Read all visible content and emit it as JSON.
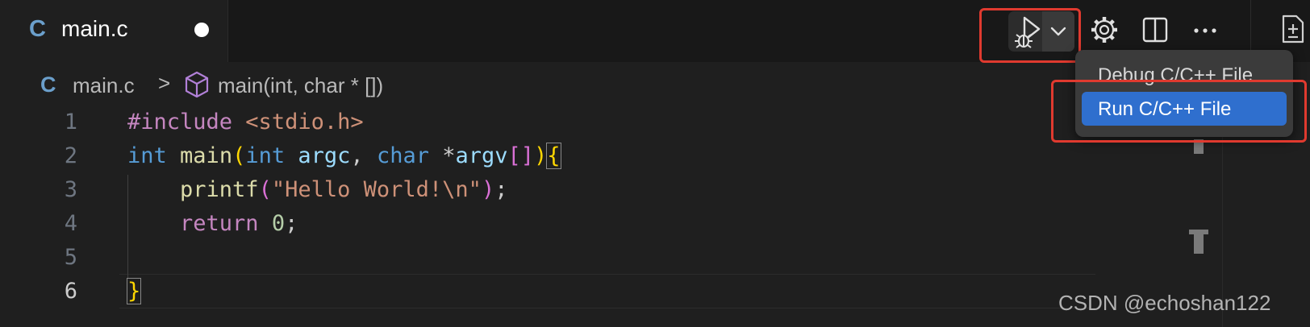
{
  "tab": {
    "lang_badge": "C",
    "title": "main.c"
  },
  "breadcrumb": {
    "lang_badge": "C",
    "file": "main.c",
    "separator": ">",
    "symbol": "main(int, char * [])"
  },
  "code": {
    "line_numbers": [
      "1",
      "2",
      "3",
      "4",
      "5",
      "6"
    ],
    "l1": {
      "directive": "#include",
      "header": " <stdio.h>"
    },
    "l2": {
      "type1": "int",
      "sp1": " ",
      "fn": "main",
      "paren_open": "(",
      "type2": "int",
      "sp2": " ",
      "argc": "argc",
      "comma": ", ",
      "type3": "char",
      "star": " *",
      "argv": "argv",
      "brackets": "[]",
      "paren_close": ")",
      "brace_open": "{"
    },
    "l3": {
      "indent": "    ",
      "fn": "printf",
      "paren_open": "(",
      "str": "\"Hello World!\\n\"",
      "paren_close": ")",
      "semi": ";"
    },
    "l4": {
      "indent": "    ",
      "kw": "return",
      "sp": " ",
      "num": "0",
      "semi": ";"
    },
    "l6": {
      "brace_close": "}"
    }
  },
  "menu": {
    "debug_label": "Debug C/C++ File",
    "run_label": "Run C/C++ File"
  },
  "watermark": "CSDN @echoshan122",
  "colors": {
    "accent_blue": "#2f6fce",
    "highlight_red": "#e03a2f",
    "c_badge": "#6b9fcb"
  },
  "icons": [
    "run-icon",
    "debug-bug-icon",
    "chevron-down-icon",
    "gear-icon",
    "split-editor-icon",
    "more-icon",
    "new-file-icon",
    "cube-icon"
  ]
}
